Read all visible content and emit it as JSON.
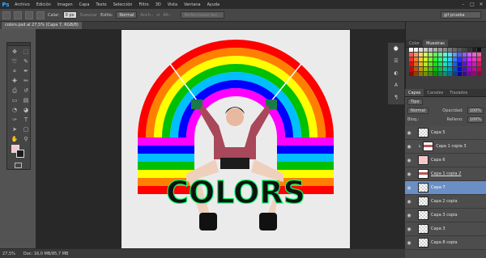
{
  "app": {
    "logo": "Ps"
  },
  "menu": [
    "Archivo",
    "Edición",
    "Imagen",
    "Capa",
    "Texto",
    "Selección",
    "Filtro",
    "3D",
    "Vista",
    "Ventana",
    "Ayuda"
  ],
  "window_controls": [
    "–",
    "□",
    "✕"
  ],
  "options_bar": {
    "calar_label": "Calar:",
    "calar_value": "0 px",
    "suavizar_label": "Suavizar",
    "estilo_label": "Estilo:",
    "estilo_value": "Normal",
    "anch_label": "Anch.:",
    "alt_label": "Alt.:",
    "refine_button": "Perfeccionar bor...",
    "workspace_value": "gif prueba"
  },
  "document": {
    "tab_label": "colors.psd al 27,5% (Capa 7, RGB/8)"
  },
  "status": {
    "zoom": "27,5%",
    "doc": "Doc: 16,0 MB/85,7 MB"
  },
  "artwork": {
    "word": "COLORS"
  },
  "colors": {
    "foreground": "#f7c6cb",
    "background": "#1b1b1b"
  },
  "swatches_panel": {
    "tabs": [
      "Color",
      "Muestras"
    ],
    "active": "Muestras"
  },
  "layers_panel": {
    "tabs": [
      "Capas",
      "Canales",
      "Trazados"
    ],
    "filter_label": "Tipo",
    "blend_mode": "Normal",
    "opacity_label": "Opacidad:",
    "opacity_value": "100%",
    "lock_label": "Bloq.:",
    "fill_label": "Relleno:",
    "fill_value": "100%",
    "layers": [
      {
        "name": "Capa 5"
      },
      {
        "name": "Capa 1 copia 3"
      },
      {
        "name": "Capa 6"
      },
      {
        "name": "Capa 1 copia 2"
      },
      {
        "name": "Capa 7"
      },
      {
        "name": "Capa 2 copia"
      },
      {
        "name": "Capa 3 copia"
      },
      {
        "name": "Capa 3"
      },
      {
        "name": "Capa 8 copia"
      }
    ]
  },
  "tools": [
    {
      "icon": "move-icon",
      "glyph": "✥"
    },
    {
      "icon": "marquee-icon",
      "glyph": "⬚"
    },
    {
      "icon": "lasso-icon",
      "glyph": "➰"
    },
    {
      "icon": "quick-select-icon",
      "glyph": "✎"
    },
    {
      "icon": "crop-icon",
      "glyph": "⌗"
    },
    {
      "icon": "eyedropper-icon",
      "glyph": "✒"
    },
    {
      "icon": "healing-icon",
      "glyph": "✚"
    },
    {
      "icon": "brush-icon",
      "glyph": "✏"
    },
    {
      "icon": "stamp-icon",
      "glyph": "⎙"
    },
    {
      "icon": "history-brush-icon",
      "glyph": "↺"
    },
    {
      "icon": "eraser-icon",
      "glyph": "▭"
    },
    {
      "icon": "gradient-icon",
      "glyph": "▤"
    },
    {
      "icon": "blur-icon",
      "glyph": "◔"
    },
    {
      "icon": "dodge-icon",
      "glyph": "◕"
    },
    {
      "icon": "pen-icon",
      "glyph": "✑"
    },
    {
      "icon": "type-icon",
      "glyph": "T"
    },
    {
      "icon": "path-select-icon",
      "glyph": "➤"
    },
    {
      "icon": "shape-icon",
      "glyph": "▢"
    },
    {
      "icon": "hand-icon",
      "glyph": "✋"
    },
    {
      "icon": "zoom-icon",
      "glyph": "⚲"
    }
  ]
}
